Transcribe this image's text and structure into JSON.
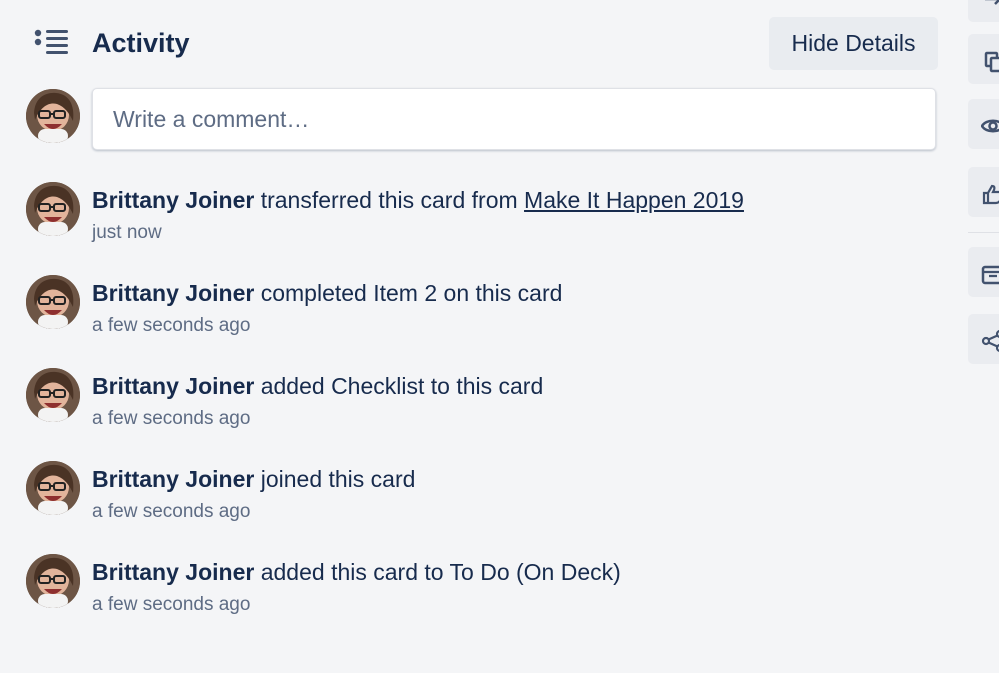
{
  "activity": {
    "title": "Activity",
    "hide_details_label": "Hide Details",
    "comment_placeholder": "Write a comment…",
    "items": [
      {
        "member": "Brittany Joiner",
        "action": "transferred this card from",
        "board_link": "Make It Happen 2019",
        "time": "just now"
      },
      {
        "member": "Brittany Joiner",
        "action": "completed Item 2 on this card",
        "time": "a few seconds ago"
      },
      {
        "member": "Brittany Joiner",
        "action": "added Checklist to this card",
        "time": "a few seconds ago"
      },
      {
        "member": "Brittany Joiner",
        "action": "joined this card",
        "time": "a few seconds ago"
      },
      {
        "member": "Brittany Joiner",
        "action": "added this card to To Do (On Deck)",
        "time": "a few seconds ago"
      }
    ]
  },
  "sidebar": {
    "icons": [
      "move-icon",
      "copy-icon",
      "watch-icon",
      "vote-icon",
      "archive-icon",
      "share-icon"
    ]
  },
  "colors": {
    "background": "#f4f5f7",
    "text": "#172b4d",
    "muted": "#5e6c84",
    "button": "#e9ecf0"
  }
}
